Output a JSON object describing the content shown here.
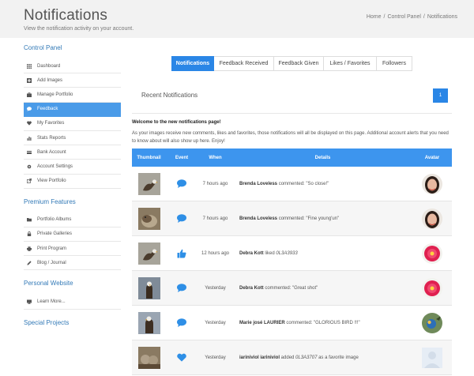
{
  "header": {
    "title": "Notifications",
    "subtitle": "View the notification activity on your account.",
    "breadcrumb": [
      "Home",
      "Control Panel",
      "Notifications"
    ]
  },
  "sidebar": {
    "control_panel": {
      "title": "Control Panel",
      "items": [
        {
          "label": "Dashboard",
          "icon": "grid-icon"
        },
        {
          "label": "Add Images",
          "icon": "plus-icon"
        },
        {
          "label": "Manage Portfolio",
          "icon": "briefcase-icon"
        },
        {
          "label": "Feedback",
          "icon": "comment-icon",
          "active": true
        },
        {
          "label": "My Favorites",
          "icon": "heart-icon"
        },
        {
          "label": "Stats Reports",
          "icon": "bar-chart-icon"
        },
        {
          "label": "Bank Account",
          "icon": "bank-icon"
        },
        {
          "label": "Account Settings",
          "icon": "gear-icon"
        },
        {
          "label": "View Portfolio",
          "icon": "external-link-icon"
        }
      ]
    },
    "premium_features": {
      "title": "Premium Features",
      "items": [
        {
          "label": "Portfolio Albums",
          "icon": "folder-open-icon"
        },
        {
          "label": "Private Galleries",
          "icon": "lock-icon"
        },
        {
          "label": "Print Program",
          "icon": "printer-icon"
        },
        {
          "label": "Blog / Journal",
          "icon": "pencil-icon"
        }
      ]
    },
    "personal_website": {
      "title": "Personal Website",
      "items": [
        {
          "label": "Learn More...",
          "icon": "monitor-icon"
        }
      ]
    },
    "special_projects": {
      "title": "Special Projects"
    }
  },
  "tabs": [
    {
      "label": "Notifications",
      "active": true
    },
    {
      "label": "Feedback Received"
    },
    {
      "label": "Feedback Given"
    },
    {
      "label": "Likes / Favorites"
    },
    {
      "label": "Followers"
    }
  ],
  "recent": {
    "title": "Recent Notifications",
    "page": "1"
  },
  "welcome": {
    "heading": "Welcome to the new notifications page!",
    "text": "As your images receive new comments, likes and favorites, those notifications will all be displayed on this page. Additional account alerts that you need to know about will also show up here. Enjoy!"
  },
  "table": {
    "columns": [
      "Thumbnail",
      "Event",
      "When",
      "Details",
      "Avatar"
    ],
    "rows": [
      {
        "event": "comment-icon",
        "when": "7 hours ago",
        "user": "Brenda Loveless",
        "action": " commented: \"So close!\"",
        "item": "",
        "tail": ""
      },
      {
        "event": "comment-icon",
        "when": "7 hours ago",
        "user": "Brenda Loveless",
        "action": " commented: \"Fine young'un\"",
        "item": "",
        "tail": ""
      },
      {
        "event": "thumbs-up-icon",
        "when": "12 hours ago",
        "user": "Debra Kott",
        "action": " liked ",
        "item": "0L3A3933",
        "tail": ""
      },
      {
        "event": "comment-icon",
        "when": "Yesterday",
        "user": "Debra Kott",
        "action": " commented: \"Great shot\"",
        "item": "",
        "tail": ""
      },
      {
        "event": "comment-icon",
        "when": "Yesterday",
        "user": "Marie josé LAURIER",
        "action": " commented: \"GLORIOUS BIRD !!!\"",
        "item": "",
        "tail": ""
      },
      {
        "event": "heart-icon",
        "when": "Yesterday",
        "user": "iariniviol iariniviol",
        "action": " added ",
        "item": "0L3A3707",
        "tail": " as a favorite image"
      }
    ]
  },
  "colors": {
    "accent": "#2a86e6",
    "table_header": "#3d95ee",
    "sidebar_active": "#4a9be8",
    "section_title": "#337ab7",
    "header_bg": "#f2f2f2"
  }
}
